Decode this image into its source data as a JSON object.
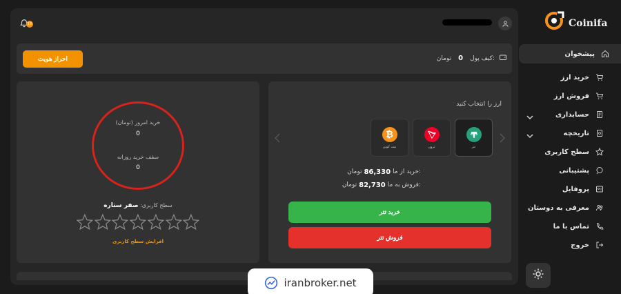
{
  "brand": {
    "name": "Coinifa"
  },
  "sidebar": {
    "items": [
      {
        "label": "پیشخوان",
        "icon": "home-icon",
        "active": true
      },
      {
        "label": "خرید ارز",
        "icon": "cart-icon"
      },
      {
        "label": "فروش ارز",
        "icon": "cart-icon"
      },
      {
        "label": "حسابداری",
        "icon": "ledger-icon",
        "expandable": true
      },
      {
        "label": "تاریخچه",
        "icon": "history-icon",
        "expandable": true
      },
      {
        "label": "سطح کاربری",
        "icon": "star-icon"
      },
      {
        "label": "پشتیبانی",
        "icon": "chat-icon"
      },
      {
        "label": "پروفایل",
        "icon": "profile-icon"
      },
      {
        "label": "معرفی به دوستان",
        "icon": "users-icon"
      },
      {
        "label": "تماس با ما",
        "icon": "phone-icon"
      },
      {
        "label": "خروج",
        "icon": "logout-icon"
      }
    ]
  },
  "header": {
    "notification_count": "16"
  },
  "wallet": {
    "label": "کیف پول:",
    "amount": "0",
    "unit": "تومان",
    "kyc_button": "احراز هویت"
  },
  "exchange": {
    "title": "ارز را انتخاب کنید",
    "coins": [
      {
        "name": "تتر",
        "icon": "tether-icon",
        "color": "#26a17b",
        "selected": true
      },
      {
        "name": "ترون",
        "icon": "tron-icon",
        "color": "#ef0027"
      },
      {
        "name": "بیت کوین",
        "icon": "bitcoin-icon",
        "color": "#f7931a"
      }
    ],
    "buy_label": "خرید از ما:",
    "buy_price": "86,330",
    "sell_label": "فروش به ما:",
    "sell_price": "82,730",
    "currency": "تومان",
    "buy_button": "خرید تتر",
    "sell_button": "فروش تتر"
  },
  "limits": {
    "today_label": "خرید امروز (تومان)",
    "today_value": "0",
    "cap_label": "سقف خرید روزانه",
    "cap_value": "0",
    "level_label": "سطح کاربری:",
    "level_value": "صفر ستاره",
    "stars_filled": 0,
    "stars_total": 7,
    "upgrade_link": "افزایش سطح کاربری"
  },
  "watermark": {
    "text": "iranbroker.net"
  },
  "colors": {
    "accent": "#f39200",
    "buy": "#36b44a",
    "sell": "#e5312b",
    "highlight_ring": "#d6231c"
  }
}
